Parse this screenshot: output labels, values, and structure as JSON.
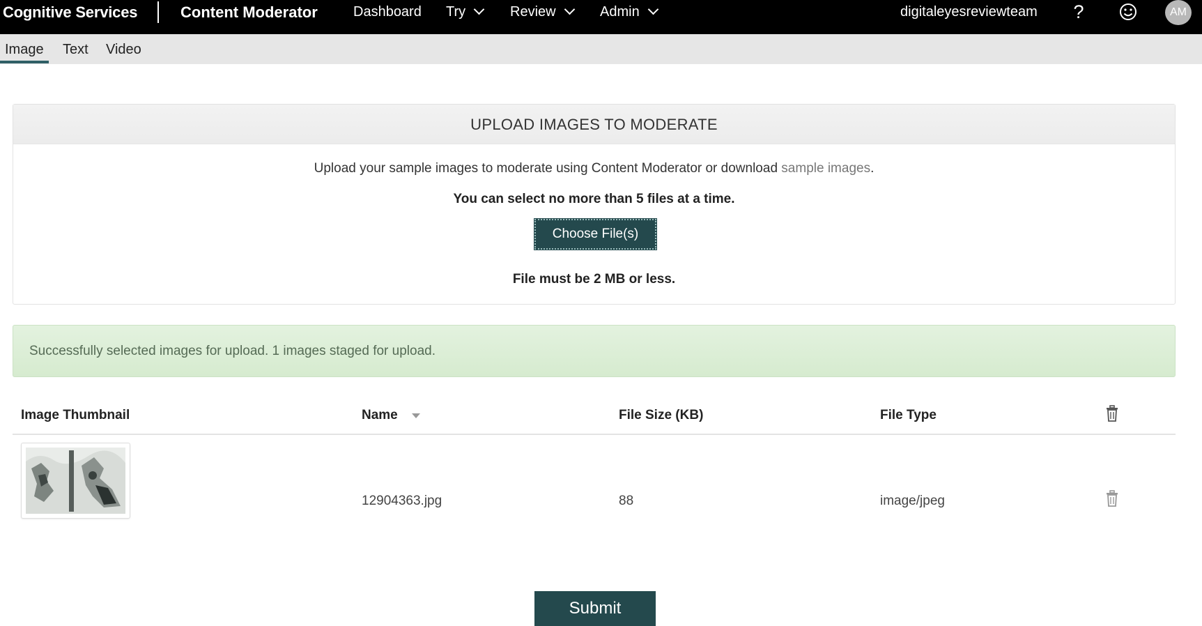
{
  "topbar": {
    "brand": "Cognitive Services",
    "product": "Content Moderator",
    "nav": [
      {
        "label": "Dashboard"
      },
      {
        "label": "Try"
      },
      {
        "label": "Review"
      },
      {
        "label": "Admin"
      }
    ],
    "user_name": "digitaleyesreviewteam",
    "help_glyph": "?",
    "avatar_initials": "AM"
  },
  "subnav": {
    "tabs": [
      {
        "label": "Image",
        "active": true
      },
      {
        "label": "Text",
        "active": false
      },
      {
        "label": "Video",
        "active": false
      }
    ]
  },
  "upload_panel": {
    "title": "UPLOAD IMAGES TO MODERATE",
    "intro_text": "Upload your sample images to moderate using Content Moderator or download ",
    "intro_link": "sample images",
    "intro_suffix": ".",
    "limit_text": "You can select no more than 5 files at a time.",
    "choose_button": "Choose File(s)",
    "size_text": "File must be 2 MB or less."
  },
  "alert": {
    "text": "Successfully selected images for upload. 1 images staged for upload."
  },
  "table": {
    "columns": {
      "thumbnail": "Image Thumbnail",
      "name": "Name",
      "size": "File Size (KB)",
      "type": "File Type"
    },
    "rows": [
      {
        "name": "12904363.jpg",
        "size_kb": "88",
        "type": "image/jpeg"
      }
    ]
  },
  "submit_button": "Submit",
  "icons": {
    "help": "help-icon",
    "feedback": "smile-icon",
    "delete": "trash-icon",
    "sort": "sort-desc-icon",
    "dropdown": "chevron-down-icon"
  },
  "colors": {
    "topbar_bg": "#000000",
    "accent": "#24494d",
    "alert_bg": "#dcefd6"
  }
}
